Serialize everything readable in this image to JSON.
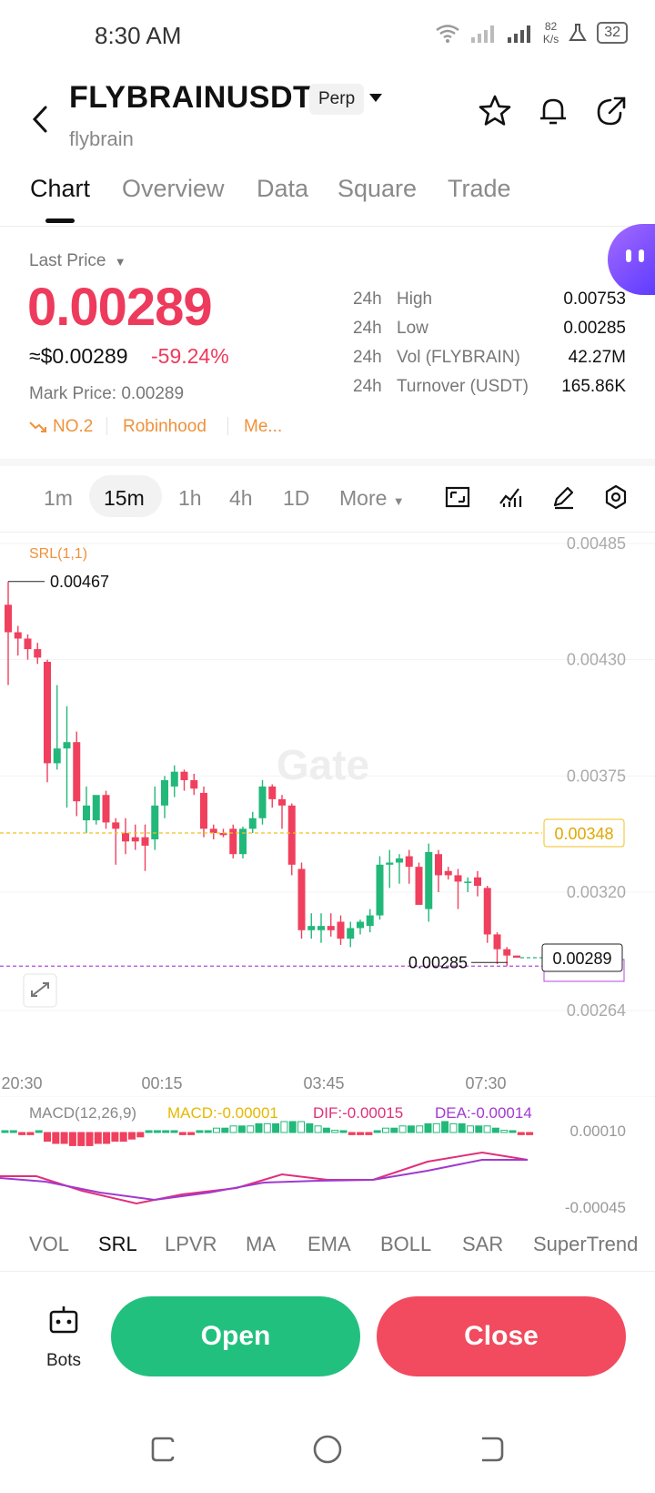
{
  "status": {
    "time": "8:30 AM",
    "net_speed_value": "82",
    "net_speed_unit": "K/s",
    "battery": "32"
  },
  "header": {
    "symbol": "FLYBRAINUSDT",
    "badge": "Perp",
    "subtitle": "flybrain"
  },
  "tabs": [
    {
      "label": "Chart",
      "active": true
    },
    {
      "label": "Overview",
      "active": false
    },
    {
      "label": "Data",
      "active": false
    },
    {
      "label": "Square",
      "active": false
    },
    {
      "label": "Trade",
      "active": false
    }
  ],
  "price": {
    "last_price_label": "Last Price",
    "value": "0.00289",
    "usd": "≈$0.00289",
    "change_pct": "-59.24%",
    "mark_price": "Mark Price: 0.00289",
    "tags": [
      "NO.2",
      "Robinhood",
      "Me..."
    ]
  },
  "stats": [
    {
      "period": "24h",
      "label": "High",
      "value": "0.00753"
    },
    {
      "period": "24h",
      "label": "Low",
      "value": "0.00285"
    },
    {
      "period": "24h",
      "label": "Vol (FLYBRAIN)",
      "value": "42.27M"
    },
    {
      "period": "24h",
      "label": "Turnover (USDT)",
      "value": "165.86K"
    }
  ],
  "intervals": {
    "items": [
      "1m",
      "15m",
      "1h",
      "4h",
      "1D"
    ],
    "selected": "15m",
    "more_label": "More"
  },
  "chart_data": {
    "type": "candlestick",
    "indicator_label": "SRL(1,1)",
    "watermark": "Gate",
    "y_ticks": [
      "0.00485",
      "0.00430",
      "0.00375",
      "0.00320",
      "0.00264"
    ],
    "x_ticks": [
      "20:30",
      "00:15",
      "03:45",
      "07:30"
    ],
    "ylim": [
      0.00264,
      0.00485
    ],
    "high_marker": "0.00467",
    "low_marker": "0.00285",
    "last_price_tag": "0.00289",
    "level_tag": "0.00348",
    "candles": [
      {
        "o": 0.00456,
        "h": 0.00467,
        "l": 0.00418,
        "c": 0.00443
      },
      {
        "o": 0.00443,
        "h": 0.00446,
        "l": 0.00432,
        "c": 0.0044
      },
      {
        "o": 0.0044,
        "h": 0.00442,
        "l": 0.0043,
        "c": 0.00435
      },
      {
        "o": 0.00435,
        "h": 0.00438,
        "l": 0.00428,
        "c": 0.00431
      },
      {
        "o": 0.00429,
        "h": 0.0043,
        "l": 0.00372,
        "c": 0.00381
      },
      {
        "o": 0.00381,
        "h": 0.00418,
        "l": 0.00378,
        "c": 0.00388
      },
      {
        "o": 0.00388,
        "h": 0.00408,
        "l": 0.0036,
        "c": 0.00391
      },
      {
        "o": 0.00391,
        "h": 0.00396,
        "l": 0.00356,
        "c": 0.00363
      },
      {
        "o": 0.00354,
        "h": 0.0037,
        "l": 0.00348,
        "c": 0.00361
      },
      {
        "o": 0.00354,
        "h": 0.00365,
        "l": 0.00352,
        "c": 0.00366
      },
      {
        "o": 0.00366,
        "h": 0.00368,
        "l": 0.0035,
        "c": 0.00353
      },
      {
        "o": 0.00353,
        "h": 0.00355,
        "l": 0.00333,
        "c": 0.0035
      },
      {
        "o": 0.00348,
        "h": 0.00355,
        "l": 0.00338,
        "c": 0.00344
      },
      {
        "o": 0.00346,
        "h": 0.00352,
        "l": 0.0034,
        "c": 0.00344
      },
      {
        "o": 0.00346,
        "h": 0.00352,
        "l": 0.0033,
        "c": 0.00342
      },
      {
        "o": 0.00345,
        "h": 0.0037,
        "l": 0.0034,
        "c": 0.00361
      },
      {
        "o": 0.00361,
        "h": 0.00375,
        "l": 0.00355,
        "c": 0.00373
      },
      {
        "o": 0.0037,
        "h": 0.0038,
        "l": 0.00365,
        "c": 0.00377
      },
      {
        "o": 0.00377,
        "h": 0.00378,
        "l": 0.00368,
        "c": 0.00373
      },
      {
        "o": 0.00373,
        "h": 0.00376,
        "l": 0.00366,
        "c": 0.00369
      },
      {
        "o": 0.00367,
        "h": 0.0037,
        "l": 0.00346,
        "c": 0.0035
      },
      {
        "o": 0.0035,
        "h": 0.00352,
        "l": 0.00345,
        "c": 0.00348
      },
      {
        "o": 0.00348,
        "h": 0.0035,
        "l": 0.00346,
        "c": 0.00347
      },
      {
        "o": 0.0035,
        "h": 0.00352,
        "l": 0.00336,
        "c": 0.00338
      },
      {
        "o": 0.00338,
        "h": 0.00351,
        "l": 0.00336,
        "c": 0.0035
      },
      {
        "o": 0.0035,
        "h": 0.00358,
        "l": 0.00348,
        "c": 0.00355
      },
      {
        "o": 0.00355,
        "h": 0.00373,
        "l": 0.00352,
        "c": 0.0037
      },
      {
        "o": 0.0037,
        "h": 0.00371,
        "l": 0.0036,
        "c": 0.00364
      },
      {
        "o": 0.00364,
        "h": 0.00366,
        "l": 0.0035,
        "c": 0.00361
      },
      {
        "o": 0.00361,
        "h": 0.00362,
        "l": 0.00328,
        "c": 0.00333
      },
      {
        "o": 0.00331,
        "h": 0.00334,
        "l": 0.00298,
        "c": 0.00302
      },
      {
        "o": 0.00302,
        "h": 0.0031,
        "l": 0.00298,
        "c": 0.00304
      },
      {
        "o": 0.00302,
        "h": 0.0031,
        "l": 0.00296,
        "c": 0.00304
      },
      {
        "o": 0.00304,
        "h": 0.0031,
        "l": 0.00299,
        "c": 0.00302
      },
      {
        "o": 0.00306,
        "h": 0.00309,
        "l": 0.00295,
        "c": 0.00298
      },
      {
        "o": 0.00298,
        "h": 0.00306,
        "l": 0.00294,
        "c": 0.00303
      },
      {
        "o": 0.00303,
        "h": 0.00307,
        "l": 0.003,
        "c": 0.00306
      },
      {
        "o": 0.00304,
        "h": 0.00312,
        "l": 0.00301,
        "c": 0.00309
      },
      {
        "o": 0.00309,
        "h": 0.00337,
        "l": 0.00307,
        "c": 0.00333
      },
      {
        "o": 0.00333,
        "h": 0.0034,
        "l": 0.00322,
        "c": 0.00334
      },
      {
        "o": 0.00334,
        "h": 0.00338,
        "l": 0.00324,
        "c": 0.00336
      },
      {
        "o": 0.00337,
        "h": 0.0034,
        "l": 0.00324,
        "c": 0.00332
      },
      {
        "o": 0.00332,
        "h": 0.00334,
        "l": 0.00318,
        "c": 0.00314
      },
      {
        "o": 0.00312,
        "h": 0.00343,
        "l": 0.00306,
        "c": 0.00339
      },
      {
        "o": 0.00338,
        "h": 0.0034,
        "l": 0.0032,
        "c": 0.00328
      },
      {
        "o": 0.0033,
        "h": 0.00332,
        "l": 0.00326,
        "c": 0.00328
      },
      {
        "o": 0.00328,
        "h": 0.00331,
        "l": 0.00312,
        "c": 0.00325
      },
      {
        "o": 0.00325,
        "h": 0.00327,
        "l": 0.0032,
        "c": 0.00325
      },
      {
        "o": 0.00327,
        "h": 0.0033,
        "l": 0.00318,
        "c": 0.00323
      },
      {
        "o": 0.00322,
        "h": 0.00323,
        "l": 0.00296,
        "c": 0.003
      },
      {
        "o": 0.003,
        "h": 0.00301,
        "l": 0.00286,
        "c": 0.00293
      },
      {
        "o": 0.00293,
        "h": 0.00294,
        "l": 0.00285,
        "c": 0.0029
      },
      {
        "o": 0.0029,
        "h": 0.0029,
        "l": 0.00289,
        "c": 0.00289
      }
    ]
  },
  "macd": {
    "title": "MACD(12,26,9)",
    "macd": "MACD:-0.00001",
    "dif": "DIF:-0.00015",
    "dea": "DEA:-0.00014",
    "y_ticks": [
      "0.00010",
      "-0.00045"
    ],
    "colors": {
      "macd": "#e6b800",
      "dif": "#e0307a",
      "dea": "#a03ad0"
    },
    "hist": [
      0,
      0,
      -1,
      -1,
      0,
      -4,
      -5,
      -5,
      -6,
      -6,
      -6,
      -5,
      -5,
      -4,
      -4,
      -3,
      -2,
      0,
      0,
      0,
      0,
      -1,
      -1,
      0,
      0,
      2,
      2,
      3,
      3,
      3,
      4,
      4,
      4,
      5,
      5,
      5,
      4,
      3,
      2,
      1,
      0,
      -1,
      -1,
      -1,
      0,
      2,
      2,
      3,
      3,
      3,
      4,
      4,
      5,
      4,
      4,
      3,
      3,
      3,
      2,
      1,
      0,
      -1,
      -1
    ]
  },
  "indicators": [
    "VOL",
    "SRL",
    "LPVR",
    "MA",
    "EMA",
    "BOLL",
    "SAR",
    "SuperTrend"
  ],
  "indicator_active": "SRL",
  "actions": {
    "bots": "Bots",
    "open": "Open",
    "close": "Close"
  }
}
